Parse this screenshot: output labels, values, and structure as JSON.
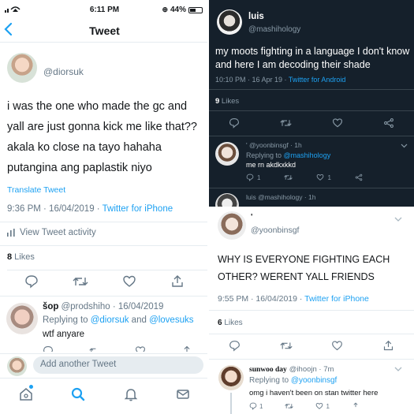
{
  "status_bar": {
    "time": "6:11 PM",
    "battery": "44%"
  },
  "left": {
    "header_title": "Tweet",
    "tweet": {
      "handle": "@diorsuk",
      "text_lines": [
        "i was the one who made the gc and",
        "yall are just gonna kick me like that??",
        "akala ko close na tayo hahaha",
        "putangina ang paplastik niyo"
      ],
      "translate": "Translate Tweet",
      "timestamp": "9:36 PM · 16/04/2019 · ",
      "source": "Twitter for iPhone",
      "activity": "View Tweet activity",
      "likes_count": "8",
      "likes_label": " Likes"
    },
    "reply": {
      "name": "šop",
      "handle": "@prodshiho · 16/04/2019",
      "replying_prefix": "Replying to ",
      "replying_to_1": "@diorsuk",
      "replying_and": " and ",
      "replying_to_2": "@lovesuks",
      "text": "wtf anyare"
    },
    "compose_placeholder": "Add another Tweet"
  },
  "right_top": {
    "name": "luis",
    "handle": "@mashihology",
    "text": "my moots fighting in a language I don't know and here I am decoding their shade",
    "timestamp": "10:10 PM · 16 Apr 19 · ",
    "source": "Twitter for Android",
    "likes_count": "9",
    "likes_label": " Likes",
    "reply": {
      "name": "' @yoonbinsgf · 1h",
      "replying_prefix": "Replying to ",
      "replying_to": "@mashihology",
      "text": "me rn akdkxkkd",
      "reply_count": "1",
      "like_count": "1"
    },
    "next_name": "luis @mashihology · 1h"
  },
  "right_bottom": {
    "name": "'",
    "handle": "@yoonbinsgf",
    "text": "WHY IS EVERYONE FIGHTING EACH OTHER? WERENT YALL FRIENDS",
    "timestamp": "9:55 PM · 16/04/2019 · ",
    "source": "Twitter for iPhone",
    "likes_count": "6",
    "likes_label": " Likes",
    "reply": {
      "name": "sunwoo day",
      "handle": "@ihoojn · 7m",
      "replying_prefix": "Replying to ",
      "replying_to": "@yoonbinsgf",
      "text": "omg i haven't been on stan twitter here",
      "reply_count": "1",
      "like_count": "1"
    }
  },
  "colors": {
    "accent": "#1da1f2",
    "dark_bg": "#15202b",
    "muted": "#657786"
  }
}
